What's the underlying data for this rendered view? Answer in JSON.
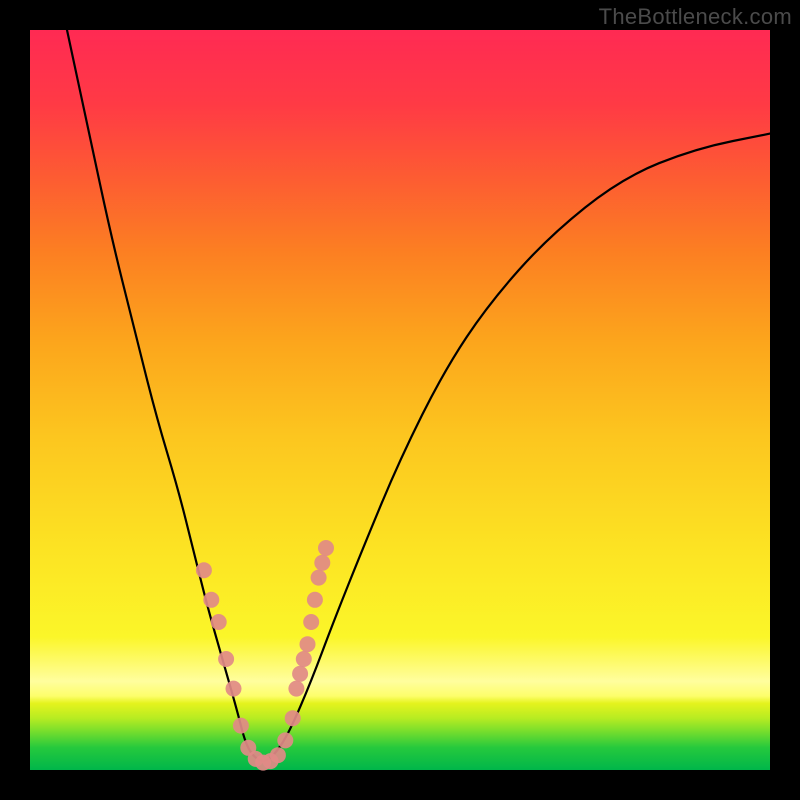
{
  "watermark": "TheBottleneck.com",
  "chart_data": {
    "type": "line",
    "title": "",
    "xlabel": "",
    "ylabel": "",
    "xlim": [
      0,
      100
    ],
    "ylim": [
      0,
      100
    ],
    "grid": false,
    "legend": false,
    "series": [
      {
        "name": "curve",
        "color": "#000000",
        "x": [
          5,
          8,
          11,
          14,
          17,
          20,
          22,
          24,
          26,
          28,
          29,
          30,
          31.5,
          33,
          35,
          38,
          41,
          45,
          50,
          56,
          62,
          70,
          80,
          90,
          100
        ],
        "y": [
          100,
          86,
          72,
          60,
          48,
          38,
          30,
          22,
          15,
          8,
          4,
          2,
          1,
          2,
          5,
          12,
          20,
          30,
          42,
          54,
          63,
          72,
          80,
          84,
          86
        ]
      }
    ],
    "markers": {
      "name": "highlight-dots",
      "color": "#e18a87",
      "radius": 8,
      "points": [
        {
          "x": 23.5,
          "y": 27
        },
        {
          "x": 24.5,
          "y": 23
        },
        {
          "x": 25.5,
          "y": 20
        },
        {
          "x": 26.5,
          "y": 15
        },
        {
          "x": 27.5,
          "y": 11
        },
        {
          "x": 28.5,
          "y": 6
        },
        {
          "x": 29.5,
          "y": 3
        },
        {
          "x": 30.5,
          "y": 1.5
        },
        {
          "x": 31.5,
          "y": 1
        },
        {
          "x": 32.5,
          "y": 1.2
        },
        {
          "x": 33.5,
          "y": 2
        },
        {
          "x": 34.5,
          "y": 4
        },
        {
          "x": 35.5,
          "y": 7
        },
        {
          "x": 36.0,
          "y": 11
        },
        {
          "x": 36.5,
          "y": 13
        },
        {
          "x": 37.0,
          "y": 15
        },
        {
          "x": 37.5,
          "y": 17
        },
        {
          "x": 38.0,
          "y": 20
        },
        {
          "x": 38.5,
          "y": 23
        },
        {
          "x": 39.0,
          "y": 26
        },
        {
          "x": 39.5,
          "y": 28
        },
        {
          "x": 40.0,
          "y": 30
        }
      ]
    },
    "gradient_bands": [
      {
        "color": "#00b64a",
        "from": 0,
        "to": 3
      },
      {
        "color": "#b7ec22",
        "from": 3,
        "to": 9
      },
      {
        "color": "#fdfe6b",
        "from": 9,
        "to": 13
      },
      {
        "color": "#fbf629",
        "from": 13,
        "to": 30
      },
      {
        "color": "#fcc61f",
        "from": 30,
        "to": 50
      },
      {
        "color": "#fc8a1e",
        "from": 50,
        "to": 70
      },
      {
        "color": "#fd5234",
        "from": 70,
        "to": 90
      },
      {
        "color": "#ff2a53",
        "from": 90,
        "to": 100
      }
    ]
  }
}
